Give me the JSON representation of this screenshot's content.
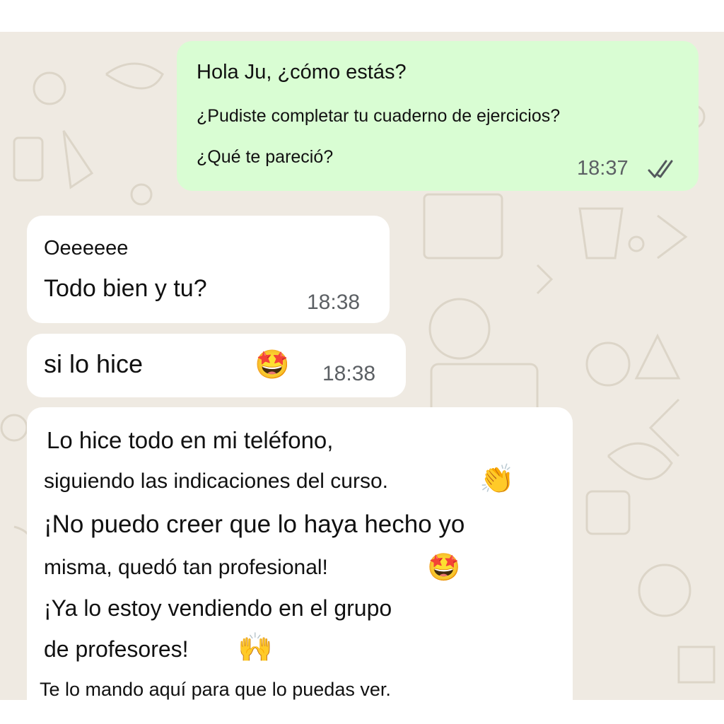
{
  "messages": {
    "outgoing": {
      "lines": [
        "Hola Ju, ¿cómo estás?",
        "¿Pudiste completar tu cuaderno de ejercicios?",
        "¿Qué te pareció?"
      ],
      "time": "18:37",
      "status_icon": "double-check-read-icon"
    },
    "incoming_1": {
      "lines": [
        "Oeeeeee",
        "Todo bien y tu?"
      ],
      "time": "18:38"
    },
    "incoming_2": {
      "text": "si lo hice",
      "emoji": "🤩",
      "time": "18:38"
    },
    "incoming_3": {
      "lines": [
        "Lo hice todo en mi teléfono,",
        "siguiendo las indicaciones del curso.",
        "¡No puedo creer que lo haya hecho yo",
        "misma, quedó tan profesional!",
        "¡Ya lo estoy vendiendo en el grupo",
        "de profesores!",
        "Te lo mando aquí para que lo puedas ver."
      ],
      "emojis": [
        "👏",
        "🤩",
        "🙌"
      ]
    }
  },
  "colors": {
    "chat_background": "#efeae2",
    "outgoing_bubble": "#d9fdd3",
    "incoming_bubble": "#ffffff",
    "timestamp": "#5c6064",
    "read_ticks": "#53585c"
  }
}
